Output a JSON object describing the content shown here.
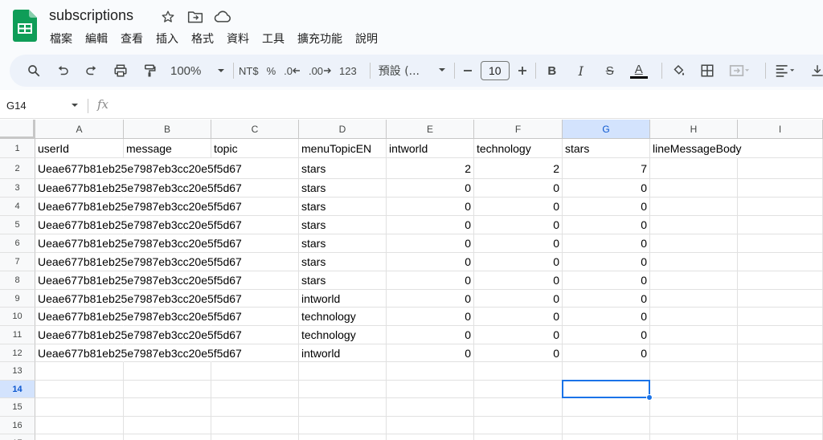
{
  "doc": {
    "title": "subscriptions"
  },
  "menus": [
    "檔案",
    "編輯",
    "查看",
    "插入",
    "格式",
    "資料",
    "工具",
    "擴充功能",
    "說明"
  ],
  "toolbar": {
    "zoom": "100%",
    "currency": "NT$",
    "percent": "%",
    "dec_decrease": ".0",
    "dec_increase": ".00",
    "number_format": "123",
    "font": "預設 (...",
    "font_size": "10",
    "bold": "B",
    "italic": "I",
    "strike": "S",
    "text_color": "A"
  },
  "formula_bar": {
    "name_box": "G14",
    "fx": "fx",
    "value": ""
  },
  "grid": {
    "columns": [
      "A",
      "B",
      "C",
      "D",
      "E",
      "F",
      "G",
      "H",
      "I"
    ],
    "selected_column": "G",
    "selected_row": 14,
    "selected_cell": "G14",
    "rows": [
      {
        "n": "1",
        "cells": [
          "userId",
          "message",
          "topic",
          "menuTopicEN",
          "intworld",
          "technology",
          "stars",
          "lineMessageBody",
          ""
        ]
      },
      {
        "n": "2",
        "cells": [
          "Ueae677b81eb25e7987eb3cc20e5f5d67",
          "",
          "",
          "stars",
          "2",
          "2",
          "7",
          "",
          ""
        ]
      },
      {
        "n": "3",
        "cells": [
          "Ueae677b81eb25e7987eb3cc20e5f5d67",
          "",
          "",
          "stars",
          "0",
          "0",
          "0",
          "",
          ""
        ]
      },
      {
        "n": "4",
        "cells": [
          "Ueae677b81eb25e7987eb3cc20e5f5d67",
          "",
          "",
          "stars",
          "0",
          "0",
          "0",
          "",
          ""
        ]
      },
      {
        "n": "5",
        "cells": [
          "Ueae677b81eb25e7987eb3cc20e5f5d67",
          "",
          "",
          "stars",
          "0",
          "0",
          "0",
          "",
          ""
        ]
      },
      {
        "n": "6",
        "cells": [
          "Ueae677b81eb25e7987eb3cc20e5f5d67",
          "",
          "",
          "stars",
          "0",
          "0",
          "0",
          "",
          ""
        ]
      },
      {
        "n": "7",
        "cells": [
          "Ueae677b81eb25e7987eb3cc20e5f5d67",
          "",
          "",
          "stars",
          "0",
          "0",
          "0",
          "",
          ""
        ]
      },
      {
        "n": "8",
        "cells": [
          "Ueae677b81eb25e7987eb3cc20e5f5d67",
          "",
          "",
          "stars",
          "0",
          "0",
          "0",
          "",
          ""
        ]
      },
      {
        "n": "9",
        "cells": [
          "Ueae677b81eb25e7987eb3cc20e5f5d67",
          "",
          "",
          "intworld",
          "0",
          "0",
          "0",
          "",
          ""
        ]
      },
      {
        "n": "10",
        "cells": [
          "Ueae677b81eb25e7987eb3cc20e5f5d67",
          "",
          "",
          "technology",
          "0",
          "0",
          "0",
          "",
          ""
        ]
      },
      {
        "n": "11",
        "cells": [
          "Ueae677b81eb25e7987eb3cc20e5f5d67",
          "",
          "",
          "technology",
          "0",
          "0",
          "0",
          "",
          ""
        ]
      },
      {
        "n": "12",
        "cells": [
          "Ueae677b81eb25e7987eb3cc20e5f5d67",
          "",
          "",
          "intworld",
          "0",
          "0",
          "0",
          "",
          ""
        ]
      },
      {
        "n": "13",
        "cells": [
          "",
          "",
          "",
          "",
          "",
          "",
          "",
          "",
          ""
        ]
      },
      {
        "n": "14",
        "cells": [
          "",
          "",
          "",
          "",
          "",
          "",
          "",
          "",
          ""
        ]
      },
      {
        "n": "15",
        "cells": [
          "",
          "",
          "",
          "",
          "",
          "",
          "",
          "",
          ""
        ]
      },
      {
        "n": "16",
        "cells": [
          "",
          "",
          "",
          "",
          "",
          "",
          "",
          "",
          ""
        ]
      },
      {
        "n": "17",
        "cells": [
          "",
          "",
          "",
          "",
          "",
          "",
          "",
          "",
          ""
        ]
      }
    ]
  },
  "colors": {
    "accent": "#1a73e8",
    "sheets_green": "#0f9d58",
    "selected_header": "#d3e3fd"
  }
}
